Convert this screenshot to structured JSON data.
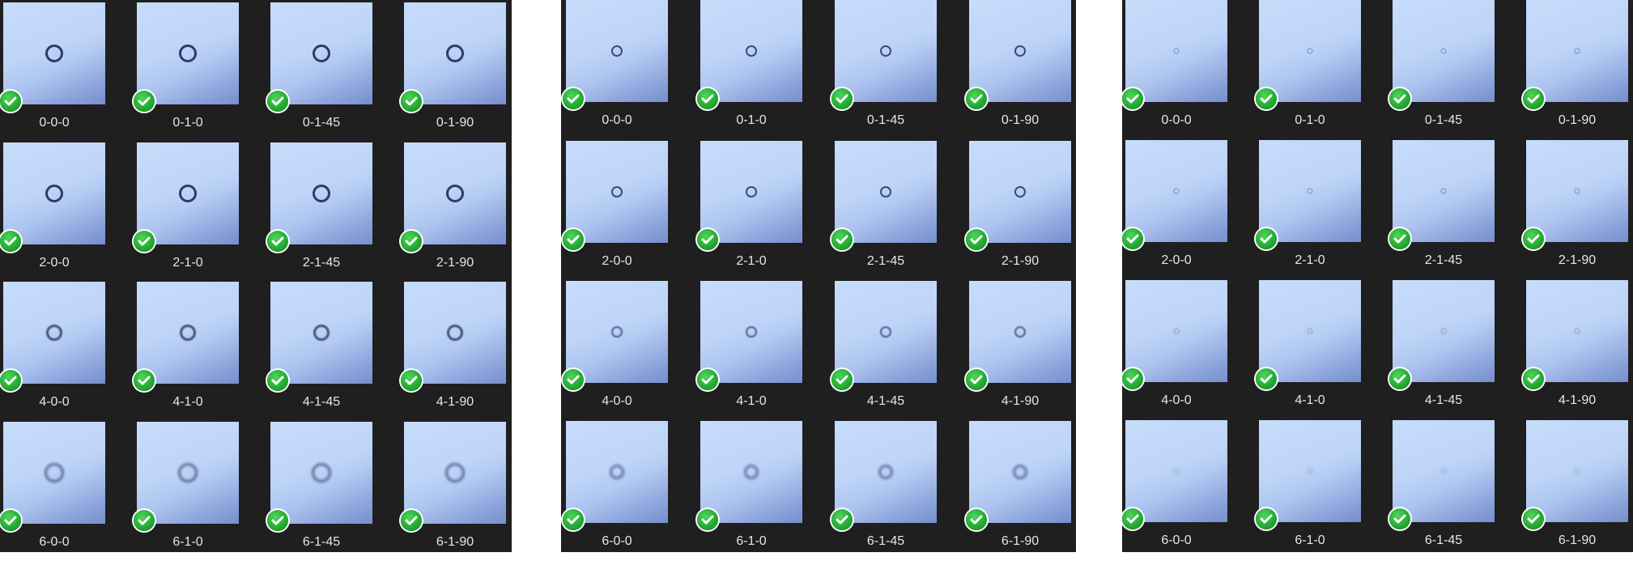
{
  "panels": [
    {
      "name": "panel-0",
      "rows": [
        {
          "labels": [
            "0-0-0",
            "0-1-0",
            "0-1-45",
            "0-1-90"
          ],
          "blur": 0
        },
        {
          "labels": [
            "2-0-0",
            "2-1-0",
            "2-1-45",
            "2-1-90"
          ],
          "blur": 0
        },
        {
          "labels": [
            "4-0-0",
            "4-1-0",
            "4-1-45",
            "4-1-90"
          ],
          "blur": 1
        },
        {
          "labels": [
            "6-0-0",
            "6-1-0",
            "6-1-45",
            "6-1-90"
          ],
          "blur": 2
        }
      ],
      "ring_color": "#2f3a68"
    },
    {
      "name": "panel-1",
      "rows": [
        {
          "labels": [
            "0-0-0",
            "0-1-0",
            "0-1-45",
            "0-1-90"
          ],
          "blur": 0
        },
        {
          "labels": [
            "2-0-0",
            "2-1-0",
            "2-1-45",
            "2-1-90"
          ],
          "blur": 0
        },
        {
          "labels": [
            "4-0-0",
            "4-1-0",
            "4-1-45",
            "4-1-90"
          ],
          "blur": 1
        },
        {
          "labels": [
            "6-0-0",
            "6-1-0",
            "6-1-45",
            "6-1-90"
          ],
          "blur": 2
        }
      ],
      "ring_color": "#3a4a80"
    },
    {
      "name": "panel-2",
      "rows": [
        {
          "labels": [
            "0-0-0",
            "0-1-0",
            "0-1-45",
            "0-1-90"
          ],
          "blur": 0
        },
        {
          "labels": [
            "2-0-0",
            "2-1-0",
            "2-1-45",
            "2-1-90"
          ],
          "blur": 0
        },
        {
          "labels": [
            "4-0-0",
            "4-1-0",
            "4-1-45",
            "4-1-90"
          ],
          "blur": 1
        },
        {
          "labels": [
            "6-0-0",
            "6-1-0",
            "6-1-45",
            "6-1-90"
          ],
          "blur": 2
        }
      ],
      "ring_color": "#7a8fc0"
    }
  ],
  "check_icon": "check-circle-icon",
  "colors": {
    "panel_bg": "#1f1f1f",
    "label_text": "#e6e6e6",
    "check_green": "#22a832"
  }
}
